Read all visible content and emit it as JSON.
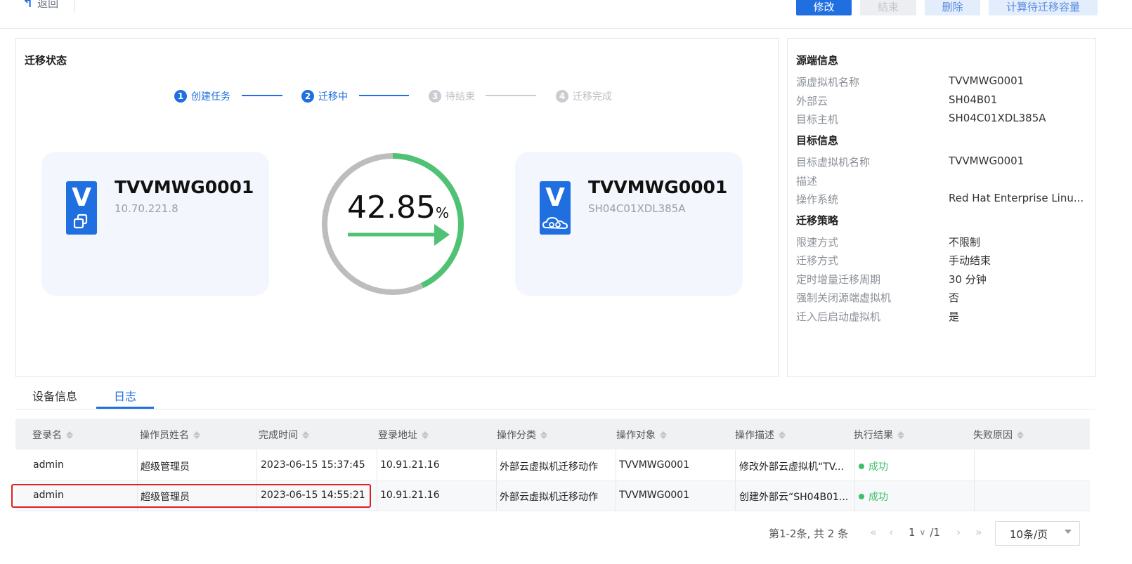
{
  "header": {
    "back_label": "返回",
    "buttons": {
      "modify": "修改",
      "finish": "结束",
      "delete": "删除",
      "calc": "计算待迁移容量"
    }
  },
  "status_panel": {
    "title": "迁移状态",
    "steps": [
      {
        "num": "1",
        "label": "创建任务"
      },
      {
        "num": "2",
        "label": "迁移中"
      },
      {
        "num": "3",
        "label": "待结束"
      },
      {
        "num": "4",
        "label": "迁移完成"
      }
    ],
    "source_vm": {
      "badge": "V",
      "name": "TVVMWG0001",
      "sub": "10.70.221.8"
    },
    "target_vm": {
      "badge": "V",
      "name": "TVVMWG0001",
      "sub": "SH04C01XDL385A"
    },
    "progress": {
      "value": "42.85",
      "unit": "%",
      "fraction": 0.4285
    }
  },
  "info_panel": {
    "source_title": "源端信息",
    "source": [
      {
        "k": "源虚拟机名称",
        "v": "TVVMWG0001"
      },
      {
        "k": "外部云",
        "v": "SH04B01"
      },
      {
        "k": "目标主机",
        "v": "SH04C01XDL385A"
      }
    ],
    "target_title": "目标信息",
    "target": [
      {
        "k": "目标虚拟机名称",
        "v": "TVVMWG0001"
      },
      {
        "k": "描述",
        "v": ""
      },
      {
        "k": "操作系统",
        "v": "Red Hat Enterprise Linu..."
      }
    ],
    "policy_title": "迁移策略",
    "policy": [
      {
        "k": "限速方式",
        "v": "不限制"
      },
      {
        "k": "迁移方式",
        "v": "手动结束"
      },
      {
        "k": "定时增量迁移周期",
        "v": "30 分钟"
      },
      {
        "k": "强制关闭源端虚拟机",
        "v": "否"
      },
      {
        "k": "迁入后启动虚拟机",
        "v": "是"
      }
    ]
  },
  "tabs": {
    "device": "设备信息",
    "log": "日志"
  },
  "table": {
    "columns": [
      "登录名",
      "操作员姓名",
      "完成时间",
      "登录地址",
      "操作分类",
      "操作对象",
      "操作描述",
      "执行结果",
      "失败原因"
    ],
    "rows": [
      [
        "admin",
        "超级管理员",
        "2023-06-15 15:37:45",
        "10.91.21.16",
        "外部云虚拟机迁移动作",
        "TVVMWG0001",
        "修改外部云虚拟机“TV...",
        "成功",
        ""
      ],
      [
        "admin",
        "超级管理员",
        "2023-06-15 14:55:21",
        "10.91.21.16",
        "外部云虚拟机迁移动作",
        "TVVMWG0001",
        "创建外部云“SH04B01...",
        "成功",
        ""
      ]
    ]
  },
  "pagination": {
    "summary": "第1-2条, 共 2 条",
    "page": "1",
    "total": "/1",
    "page_size": "10条/页"
  },
  "colors": {
    "accent": "#1f6fe0",
    "success": "#3cbf6a",
    "highlight": "#e02020"
  }
}
